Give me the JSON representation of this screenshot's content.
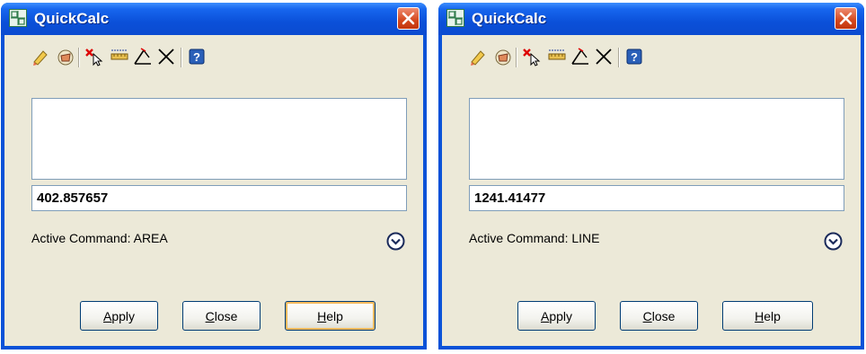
{
  "colors": {
    "title_bar": "#0b50d9",
    "client": "#ece9d8",
    "close_button": "#d4471d",
    "field_border": "#7f9db9"
  },
  "windows": [
    {
      "title": "QuickCalc",
      "input_value": "402.857657",
      "status": "Active Command: AREA",
      "buttons": {
        "apply": {
          "mnemonic": "A",
          "rest": "pply"
        },
        "close": {
          "mnemonic": "C",
          "rest": "lose"
        },
        "help": {
          "mnemonic": "H",
          "rest": "elp",
          "focused": true
        }
      }
    },
    {
      "title": "QuickCalc",
      "input_value": "1241.41477",
      "status": "Active Command: LINE",
      "buttons": {
        "apply": {
          "mnemonic": "A",
          "rest": "pply"
        },
        "close": {
          "mnemonic": "C",
          "rest": "lose"
        },
        "help": {
          "mnemonic": "H",
          "rest": "elp",
          "focused": false
        }
      }
    }
  ],
  "toolbar_icons": [
    "clear-eraser-icon",
    "clear-history-icon",
    "get-coordinates-icon",
    "distance-between-points-icon",
    "angle-of-line-icon",
    "intersection-icon",
    "help-icon"
  ]
}
